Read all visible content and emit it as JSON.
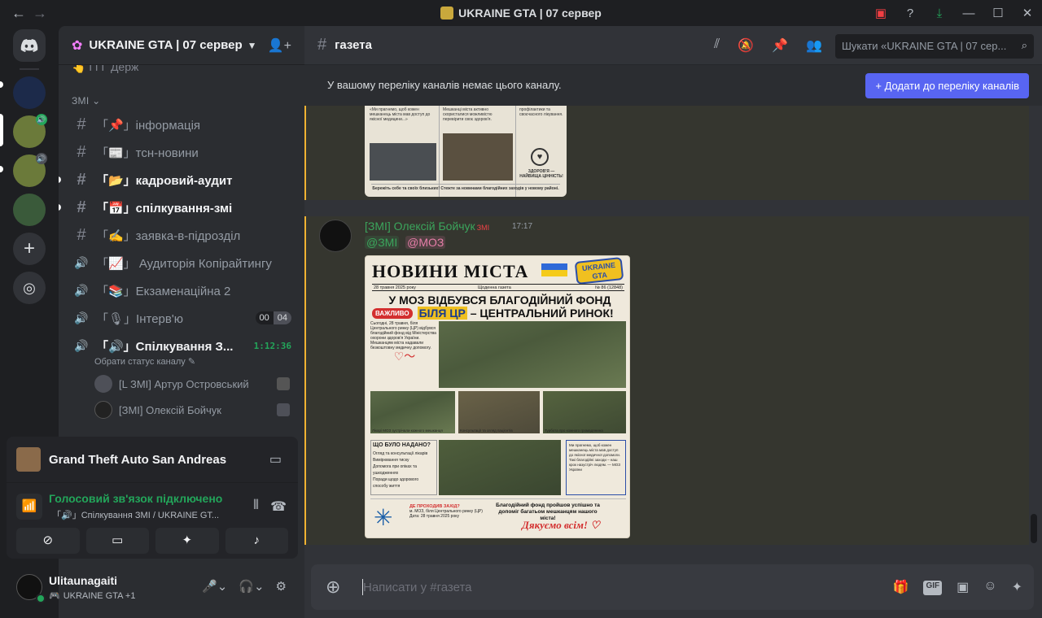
{
  "window": {
    "title": "UKRAINE GTA | 07 сервер",
    "back_icon": "←",
    "forward_icon": "→"
  },
  "server": {
    "name": "UKRAINE GTA | 07 сервер",
    "cut_channel": "👆 ГГГ Держ",
    "category": "ЗМІ"
  },
  "channels": [
    {
      "name": "「📌」інформація",
      "type": "text",
      "unread": false
    },
    {
      "name": "「📰」тсн-новини",
      "type": "text",
      "unread": false
    },
    {
      "name": "「📂」кадровий-аудит",
      "type": "text",
      "unread": true
    },
    {
      "name": "「📅」спілкування-змі",
      "type": "text",
      "unread": true
    },
    {
      "name": "「✍」заявка-в-підрозділ",
      "type": "text",
      "unread": false
    },
    {
      "name": "「📈」 Аудиторія Копірайтингу",
      "type": "voice",
      "unread": false
    },
    {
      "name": "「📚」Екзаменаційна 2",
      "type": "voice",
      "unread": false
    },
    {
      "name": "「🎙」Інтерв'ю",
      "type": "voice",
      "unread": false,
      "count_a": "00",
      "count_b": "04"
    },
    {
      "name": "「🔊」Спілкування З...",
      "type": "voice",
      "active": true,
      "timer": "1:12:36"
    }
  ],
  "channel_status_hint": "Обрати статус каналу ✎",
  "voice_users": [
    {
      "name": "[L ЗМІ] Артур Островський"
    },
    {
      "name": "[ЗМІ] Олексій Бойчук"
    }
  ],
  "activity": {
    "game": "Grand Theft Auto San Andreas",
    "voice_status": "Голосовий зв'язок підключено",
    "voice_location": "「🔊」Спілкування ЗМІ / UKRAINE GT..."
  },
  "user": {
    "name": "Ulitaunagaiti",
    "sub": "UKRAINE GTA +1"
  },
  "main": {
    "channel_name": "газета",
    "search_placeholder": "Шукати «UKRAINE GTA | 07 сер...",
    "notice_text": "У вашому переліку каналів немає цього каналу.",
    "notice_button": "+  Додати до переліку каналів",
    "composer_placeholder": "Написати у #газета"
  },
  "message": {
    "author": "[ЗМІ] Олексій Бойчук",
    "author_tag": "ЗМІ",
    "time": "17:17",
    "mention_1": "@ЗМІ",
    "mention_2": "@МОЗ"
  },
  "top_image": {
    "col1": "«Ми прагнемо, щоб кожен мешканець міста мав доступ до якісної медицини...»",
    "col2": "Мешканці міста активно скористалися можливістю перевірити своє здоров'я.",
    "col3": "профілактики та своєчасного лікування.",
    "col3_icon": "ЗДОРОВ'Я — НАЙВИЩА ЦІННІСТЬ!",
    "footer": "Бережіть себе та своїх близьких! Стежте за новинами благодійних заходів у новому районі."
  },
  "newspaper": {
    "title": "НОВИНИ МІСТА",
    "logo": "UKRAINE GTA",
    "date": "28 травня 2025 року",
    "type": "Щоденна газета",
    "issue": "№ 86 (12848)",
    "head1": "У МОЗ ВІДБУВСЯ БЛАГОДІЙНИЙ ФОНД",
    "head2_badge": "ВАЖЛИВО",
    "head2_a": "БІЛЯ ЦР",
    "head2_b": " – ЦЕНТРАЛЬНИЙ РИНОК!",
    "lede": "Сьогодні, 28 травня, біля Центрального ринку (ЦР) відбувся благодійний фонд від Міністерства охорони здоров'я України. Мешканцям міста надавали безкоштовну медичну допомогу.",
    "cap1": "Лікарі МОЗ зустрічали кожного мешканця",
    "cap2": "Консультації та огляд пацієнтів",
    "cap3": "Турбота про кожного громадянина",
    "box_title": "ЩО БУЛО НАДАНО?",
    "box_items": [
      "Огляд та консультації лікарів",
      "Вимірювання тиску",
      "Допомога при опіках та ушкодженнях",
      "Поради щодо здорового способу життя"
    ],
    "quote": "Ми прагнемо, щоб кожен мешканець міста мав доступ до якісної медичної допомоги. Такі благодійні заходи – наш крок назустріч людям. — МОЗ України",
    "foot_title": "ДЕ ПРОХОДИВ ЗАХІД?",
    "foot_loc": "м. МОЗ, біля Центрального ринку (ЦР)",
    "foot_date": "Дата: 28 травня 2025 року",
    "foot_msg": "Благодійний фонд пройшов успішно та допоміг багатьом мешканцям нашого міста!",
    "thanks": "Дякуємо всім!"
  },
  "colors": {
    "accent": "#5865f2",
    "green": "#23a55a",
    "mention_highlight": "#f0b232"
  }
}
